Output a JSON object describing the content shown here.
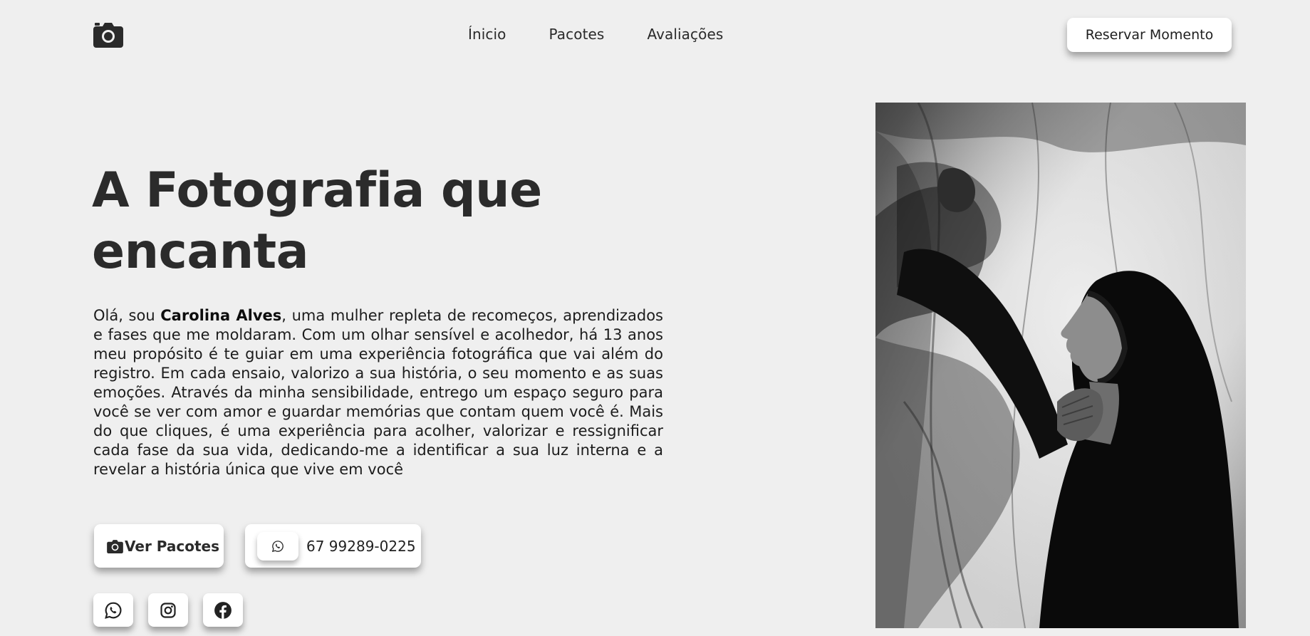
{
  "header": {
    "logo_icon": "camera-icon",
    "nav": [
      "Ínicio",
      "Pacotes",
      "Avaliações"
    ],
    "cta_label": "Reservar Momento"
  },
  "hero": {
    "title_line1": "A Fotografia que",
    "title_line2": "encanta",
    "bio_prefix": "Olá, sou ",
    "bio_name": "Carolina Alves",
    "bio_text": ", uma mulher repleta de recomeços, aprendizados e fases que me moldaram. Com um olhar sensível e acolhedor, há 13 anos meu propósito é te guiar em uma experiência fotográfica que vai além do registro. Em cada ensaio, valorizo a sua história, o seu momento e as suas emoções. Através da minha sensibilidade, entrego um espaço seguro para você se ver com amor e guardar memórias que contam quem você é. Mais do que cliques, é uma experiência para acolher, valorizar e ressignificar cada fase da sua vida, dedicando-me a identificar a sua luz interna e a revelar a história única que vive em você",
    "packages_label": "Ver Pacotes",
    "phone": "67 99289-0225"
  },
  "social": [
    "whatsapp-icon",
    "instagram-icon",
    "facebook-icon"
  ],
  "colors": {
    "background": "#efefef",
    "button_bg": "#ffffff",
    "text_dark": "#2b2b2b"
  }
}
